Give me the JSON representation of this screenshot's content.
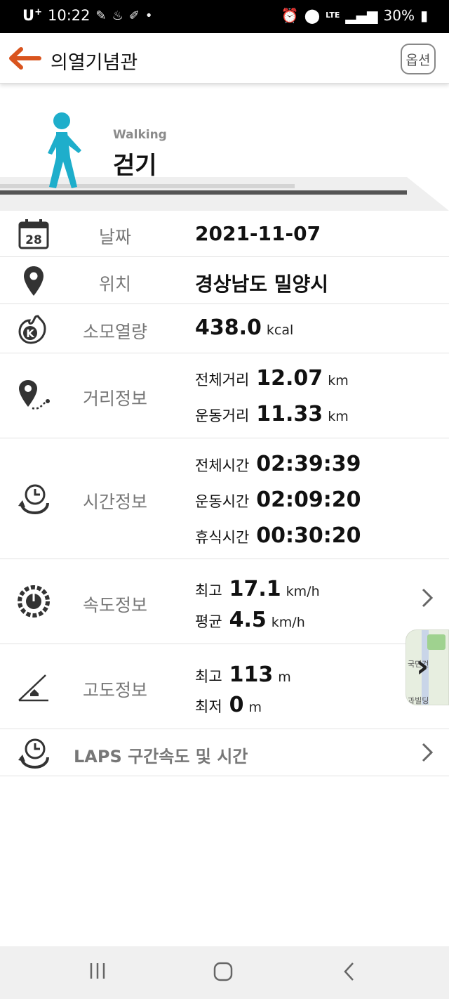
{
  "status": {
    "carrier": "U",
    "carrier_sup": "+",
    "time": "10:22",
    "network": "LTE",
    "battery": "30%"
  },
  "appbar": {
    "title": "의열기념관",
    "options_label": "옵션"
  },
  "activity": {
    "name_en": "Walking",
    "name_ko": "걷기"
  },
  "date": {
    "label": "날짜",
    "value": "2021-11-07",
    "icon_day": "28"
  },
  "location": {
    "label": "위치",
    "value": "경상남도 밀양시"
  },
  "calories": {
    "label": "소모열량",
    "value": "438.0",
    "unit": "kcal"
  },
  "distance": {
    "label": "거리정보",
    "items": [
      {
        "key": "전체거리",
        "value": "12.07",
        "unit": "km"
      },
      {
        "key": "운동거리",
        "value": "11.33",
        "unit": "km"
      }
    ]
  },
  "time": {
    "label": "시간정보",
    "items": [
      {
        "key": "전체시간",
        "value": "02:39:39"
      },
      {
        "key": "운동시간",
        "value": "02:09:20"
      },
      {
        "key": "휴식시간",
        "value": "00:30:20"
      }
    ]
  },
  "speed": {
    "label": "속도정보",
    "items": [
      {
        "key": "최고",
        "value": "17.1",
        "unit": "km/h"
      },
      {
        "key": "평균",
        "value": "4.5",
        "unit": "km/h"
      }
    ]
  },
  "altitude": {
    "label": "고도정보",
    "items": [
      {
        "key": "최고",
        "value": "113",
        "unit": "m"
      },
      {
        "key": "최저",
        "value": "0",
        "unit": "m"
      }
    ]
  },
  "laps": {
    "label": "LAPS 구간속도 및 시간"
  },
  "map_thumb": {
    "text1": "국민건",
    "text2": "과빌딩"
  },
  "colors": {
    "accent": "#d9541e",
    "walker": "#1eaecb",
    "label_gray": "#777777"
  }
}
